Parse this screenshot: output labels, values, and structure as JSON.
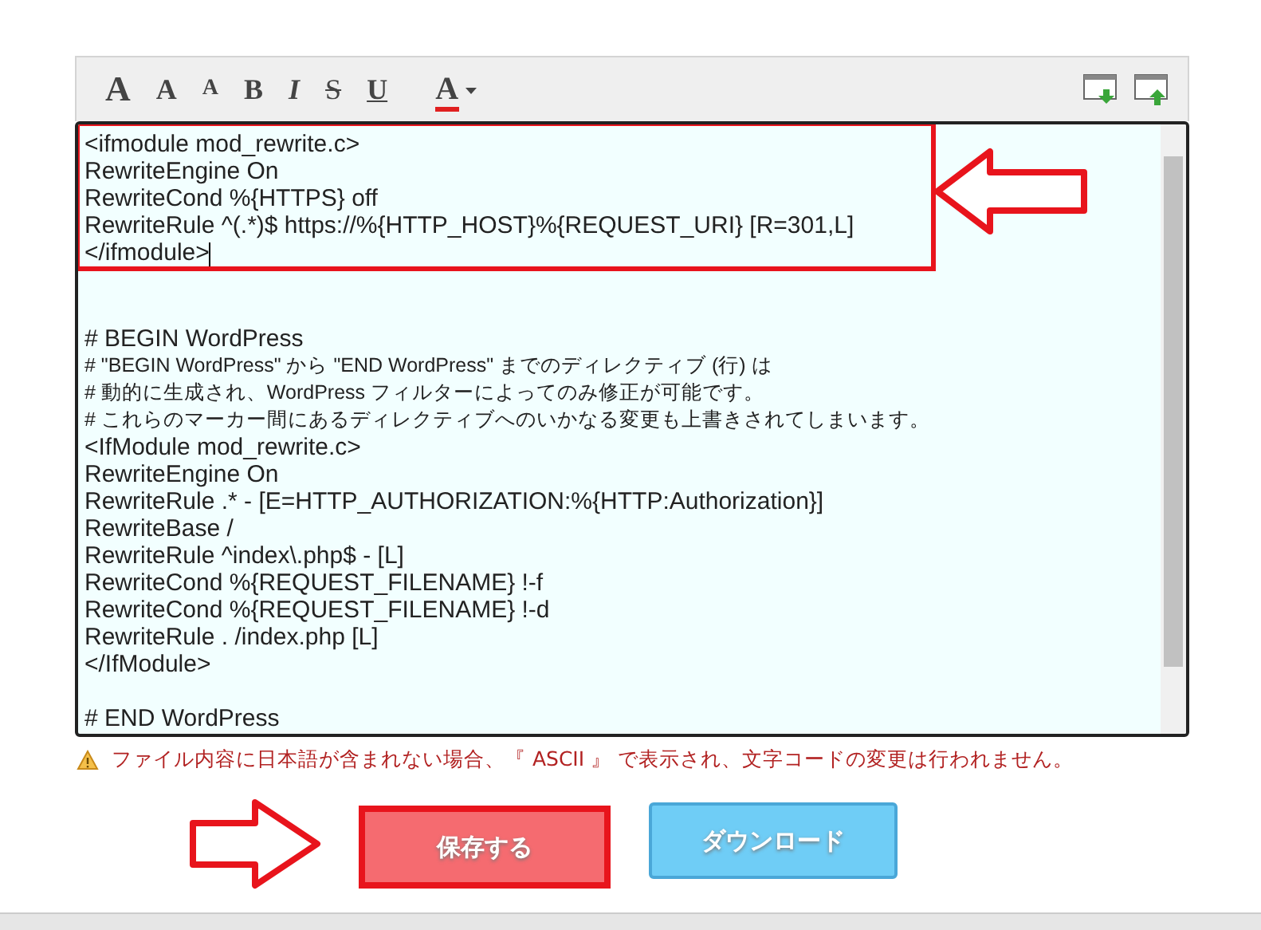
{
  "toolbar": {
    "format_buttons": [
      {
        "label": "A",
        "kind": "large"
      },
      {
        "label": "A",
        "kind": "medium"
      },
      {
        "label": "A",
        "kind": "small"
      },
      {
        "label": "B",
        "kind": "bold"
      },
      {
        "label": "I",
        "kind": "italic"
      },
      {
        "label": "S",
        "kind": "strike"
      },
      {
        "label": "U",
        "kind": "underline"
      },
      {
        "label": "A",
        "kind": "color",
        "color": "#e02020"
      }
    ]
  },
  "editor": {
    "lines": [
      {
        "kind": "text",
        "text": "<ifmodule mod_rewrite.c>",
        "highlighted": true
      },
      {
        "kind": "text",
        "text": "RewriteEngine On",
        "highlighted": true
      },
      {
        "kind": "text",
        "text": "RewriteCond %{HTTPS} off",
        "highlighted": true
      },
      {
        "kind": "text",
        "text": "RewriteRule ^(.*)$ https://%{HTTP_HOST}%{REQUEST_URI} [R=301,L]",
        "highlighted": true
      },
      {
        "kind": "text",
        "text": "</ifmodule>",
        "highlighted": true
      },
      {
        "kind": "blank"
      },
      {
        "kind": "blank"
      },
      {
        "kind": "text",
        "text": "# BEGIN WordPress",
        "highlighted": false
      },
      {
        "kind": "text",
        "text": "# \"BEGIN WordPress\" から \"END WordPress\" までのディレクティブ (行) は",
        "highlighted": false
      },
      {
        "kind": "text",
        "text": "# 動的に生成され、WordPress フィルターによってのみ修正が可能です。",
        "highlighted": false
      },
      {
        "kind": "text",
        "text": "# これらのマーカー間にあるディレクティブへのいかなる変更も上書きされてしまいます。",
        "highlighted": false
      },
      {
        "kind": "text",
        "text": "<IfModule mod_rewrite.c>",
        "highlighted": false
      },
      {
        "kind": "text",
        "text": "RewriteEngine On",
        "highlighted": false
      },
      {
        "kind": "text",
        "text": "RewriteRule .* - [E=HTTP_AUTHORIZATION:%{HTTP:Authorization}]",
        "highlighted": false
      },
      {
        "kind": "text",
        "text": "RewriteBase /",
        "highlighted": false
      },
      {
        "kind": "text",
        "text": "RewriteRule ^index\\.php$ - [L]",
        "highlighted": false
      },
      {
        "kind": "text",
        "text": "RewriteCond %{REQUEST_FILENAME} !-f",
        "highlighted": false
      },
      {
        "kind": "text",
        "text": "RewriteCond %{REQUEST_FILENAME} !-d",
        "highlighted": false
      },
      {
        "kind": "text",
        "text": "RewriteRule . /index.php [L]",
        "highlighted": false
      },
      {
        "kind": "text",
        "text": "</IfModule>",
        "highlighted": false
      },
      {
        "kind": "blank"
      },
      {
        "kind": "text",
        "text": "# END WordPress",
        "highlighted": false
      }
    ]
  },
  "warning": "ファイル内容に日本語が含まれない場合、『 ASCII 』 で表示され、文字コードの変更は行われません。",
  "buttons": [
    {
      "label": "保存する",
      "kind": "save",
      "highlighted": true
    },
    {
      "label": "ダウンロード",
      "kind": "download",
      "highlighted": false
    }
  ]
}
